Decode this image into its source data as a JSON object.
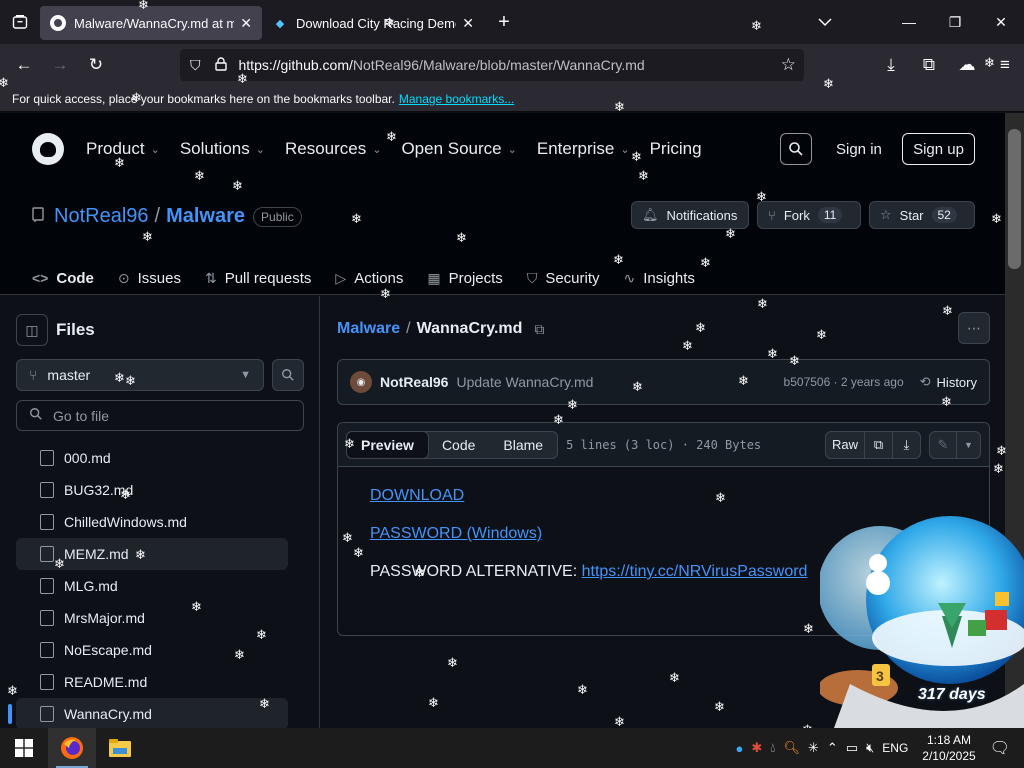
{
  "browser": {
    "tabs": [
      {
        "title": "Malware/WannaCry.md at mast",
        "active": true
      },
      {
        "title": "Download City Racing Demo fo",
        "active": false
      }
    ],
    "url": {
      "host_part": "https://github.com/",
      "path_part": "NotReal96/Malware/blob/master/WannaCry.md"
    },
    "bookmarks_text": "For quick access, place your bookmarks here on the bookmarks toolbar.",
    "bookmarks_link": "Manage bookmarks..."
  },
  "gh_header": {
    "nav": [
      "Product",
      "Solutions",
      "Resources",
      "Open Source",
      "Enterprise",
      "Pricing"
    ],
    "nav_has_chevron": [
      true,
      true,
      true,
      true,
      true,
      false
    ],
    "sign_in": "Sign in",
    "sign_up": "Sign up"
  },
  "repo": {
    "owner": "NotReal96",
    "name": "Malware",
    "visibility": "Public",
    "notifications": "Notifications",
    "fork_label": "Fork",
    "fork_count": "11",
    "star_label": "Star",
    "star_count": "52",
    "tabs": [
      "Code",
      "Issues",
      "Pull requests",
      "Actions",
      "Projects",
      "Security",
      "Insights"
    ]
  },
  "files_panel": {
    "title": "Files",
    "branch": "master",
    "goto_placeholder": "Go to file",
    "files": [
      "000.md",
      "BUG32.md",
      "ChilledWindows.md",
      "MEMZ.md",
      "MLG.md",
      "MrsMajor.md",
      "NoEscape.md",
      "README.md",
      "WannaCry.md"
    ],
    "hover_index": 3,
    "active_index": 8
  },
  "file_view": {
    "crumb_repo": "Malware",
    "crumb_file": "WannaCry.md",
    "commit_author": "NotReal96",
    "commit_message": "Update WannaCry.md",
    "commit_meta": "b507506 · 2 years ago",
    "history": "History",
    "view_tabs": [
      "Preview",
      "Code",
      "Blame"
    ],
    "file_info": "5 lines (3 loc) · 240 Bytes",
    "raw": "Raw",
    "lines": {
      "download_link": "DOWNLOAD",
      "password_link": "PASSWORD (Windows)",
      "alt_label": "PASSWORD ALTERNATIVE: ",
      "alt_link": "https://tiny.cc/NRVirusPassword"
    }
  },
  "globe": {
    "days_label": "317 days",
    "number_badge": "3"
  },
  "taskbar": {
    "language": "ENG",
    "time": "1:18 AM",
    "date": "2/10/2025"
  },
  "colors": {
    "accent_link": "#4493f8",
    "tab_underline": "#f78166",
    "bg": "#0d1117"
  }
}
